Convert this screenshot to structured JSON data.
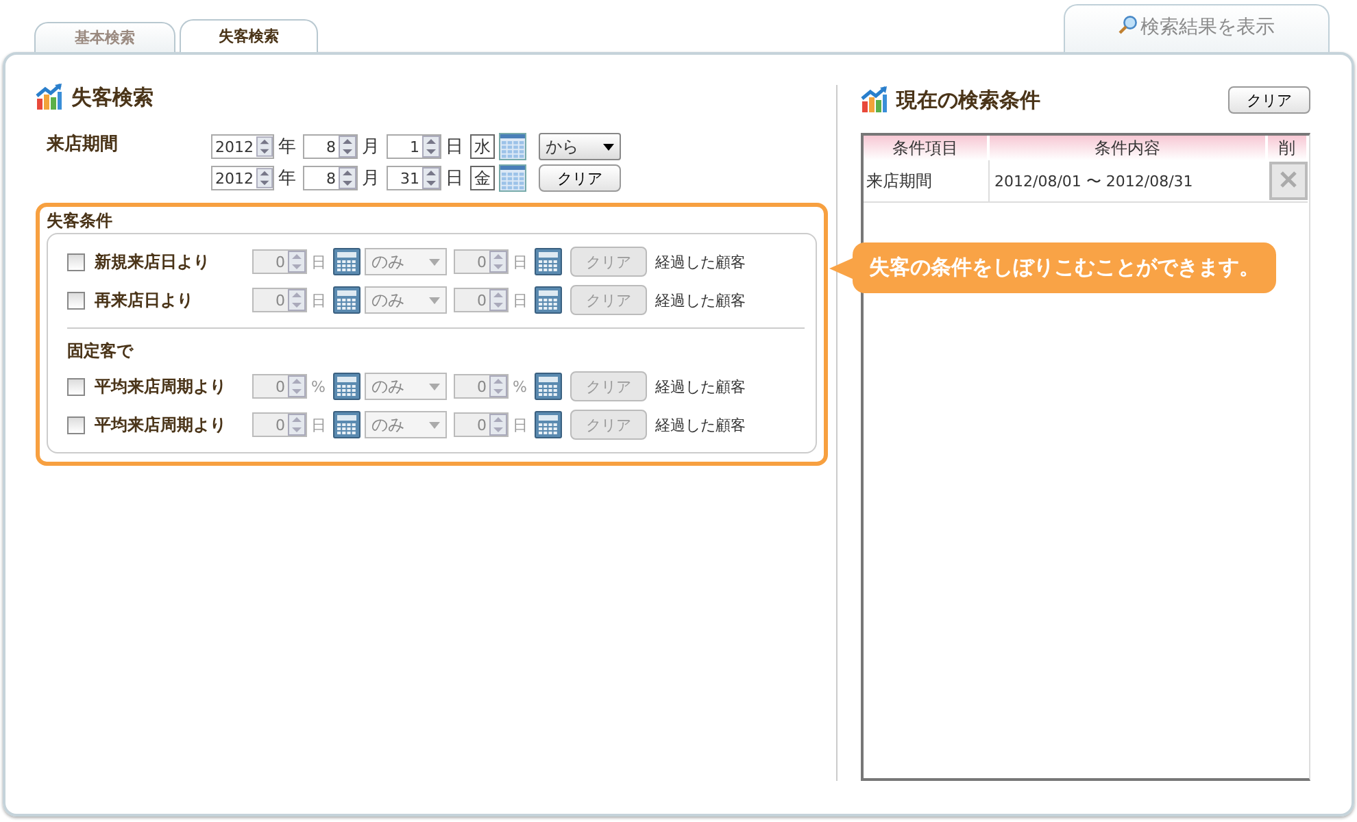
{
  "tabs": [
    {
      "label": "基本検索",
      "selected": false
    },
    {
      "label": "失客検索",
      "selected": true
    }
  ],
  "result_tab": {
    "label": "検索結果を表示"
  },
  "search": {
    "title": "失客検索",
    "period": {
      "label": "来店期間",
      "rows": [
        {
          "year": "2012",
          "year_unit": "年",
          "month": "8",
          "month_unit": "月",
          "day": "1",
          "day_unit": "日",
          "weekday": "水"
        },
        {
          "year": "2012",
          "year_unit": "年",
          "month": "8",
          "month_unit": "月",
          "day": "31",
          "day_unit": "日",
          "weekday": "金"
        }
      ],
      "range_select": "から",
      "clear": "クリア"
    },
    "conditions": {
      "title": "失客条件",
      "groups": [
        {
          "rows": [
            {
              "label": "新規来店日より",
              "checked": false,
              "disabled": true,
              "from": "0",
              "unit": "日",
              "mode": "のみ",
              "to": "0",
              "unit2": "日",
              "clear": "クリア",
              "suffix": "経過した顧客"
            },
            {
              "label": "再来店日より",
              "checked": false,
              "disabled": true,
              "from": "0",
              "unit": "日",
              "mode": "のみ",
              "to": "0",
              "unit2": "日",
              "clear": "クリア",
              "suffix": "経過した顧客"
            }
          ]
        },
        {
          "heading": "固定客で",
          "rows": [
            {
              "label": "平均来店周期より",
              "checked": false,
              "disabled": true,
              "from": "0",
              "unit": "%",
              "mode": "のみ",
              "to": "0",
              "unit2": "%",
              "clear": "クリア",
              "suffix": "経過した顧客"
            },
            {
              "label": "平均来店周期より",
              "checked": false,
              "disabled": true,
              "from": "0",
              "unit": "日",
              "mode": "のみ",
              "to": "0",
              "unit2": "日",
              "clear": "クリア",
              "suffix": "経過した顧客"
            }
          ]
        }
      ]
    }
  },
  "current": {
    "title": "現在の検索条件",
    "clear": "クリア",
    "columns": [
      "条件項目",
      "条件内容",
      "削"
    ],
    "rows": [
      {
        "item": "来店期間",
        "content": "2012/08/01 〜 2012/08/31"
      }
    ]
  },
  "callout": {
    "text": "失客の条件をしぼりこむことができます。"
  }
}
